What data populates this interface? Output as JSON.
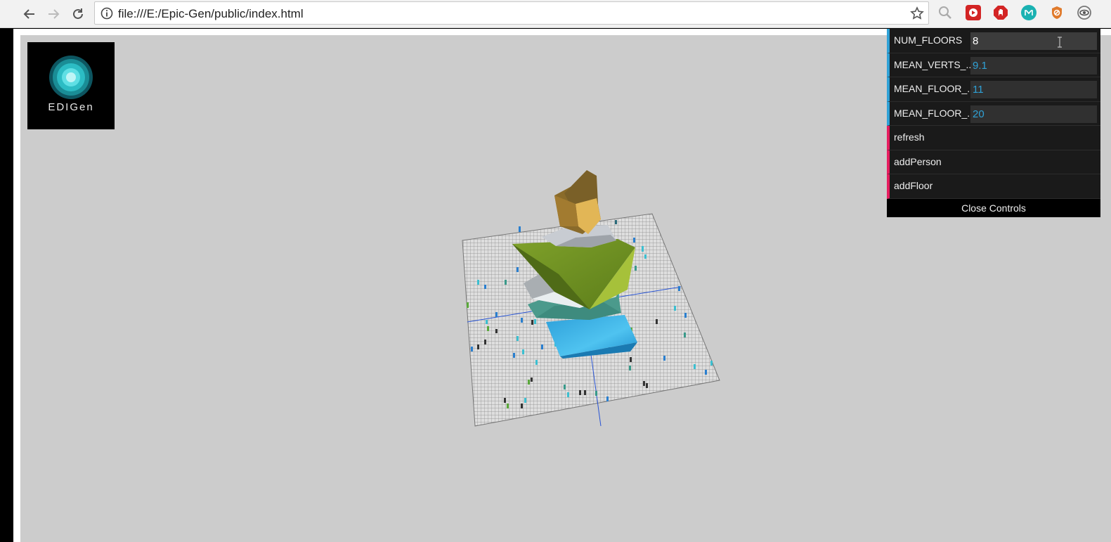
{
  "browser": {
    "url": "file:///E:/Epic-Gen/public/index.html",
    "extensions": [
      "search-extension-icon",
      "youtube-extension-icon",
      "adblock-extension-icon",
      "mercury-extension-icon",
      "privacy-badger-icon",
      "eye-extension-icon"
    ]
  },
  "logo": {
    "text": "EDIGen"
  },
  "gui": {
    "rows": [
      {
        "label": "NUM_FLOORS",
        "value": "8",
        "type": "number"
      },
      {
        "label": "MEAN_VERTS_...",
        "value": "9.1",
        "type": "number"
      },
      {
        "label": "MEAN_FLOOR_...",
        "value": "11",
        "type": "number"
      },
      {
        "label": "MEAN_FLOOR_...",
        "value": "20",
        "type": "number"
      },
      {
        "label": "refresh",
        "type": "function"
      },
      {
        "label": "addPerson",
        "type": "function"
      },
      {
        "label": "addFloor",
        "type": "function"
      }
    ],
    "close_label": "Close Controls"
  },
  "colors": {
    "canvas_bg": "#cccccc",
    "gui_number_accent": "#2fa1d6",
    "gui_function_accent": "#e61d5f"
  }
}
